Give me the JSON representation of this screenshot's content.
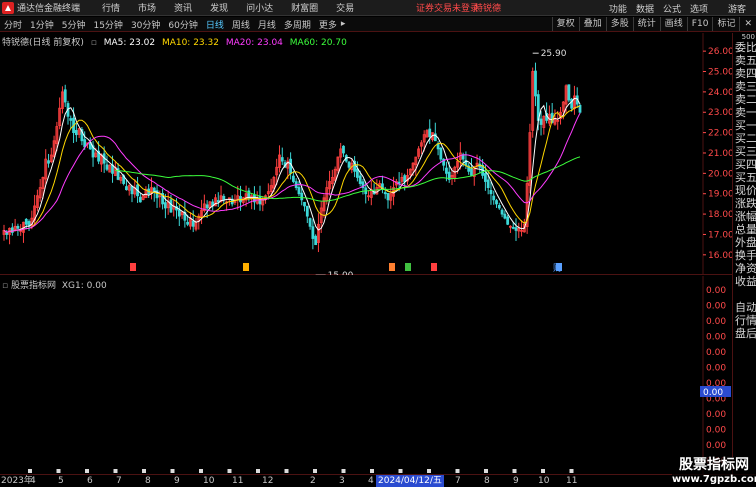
{
  "menubar": {
    "title": "通达信金融终端",
    "items": [
      "行情",
      "市场",
      "资讯",
      "发现",
      "问小达",
      "财富圈",
      "交易"
    ],
    "alert": "证券交易未登录",
    "alert_stock": "特锐德",
    "right_items": [
      "功能",
      "数据",
      "公式",
      "选项",
      "游客"
    ]
  },
  "periodbar": {
    "items": [
      "分时",
      "1分钟",
      "5分钟",
      "15分钟",
      "30分钟",
      "60分钟",
      "日线",
      "周线",
      "月线",
      "多周期",
      "更多"
    ],
    "active": "日线",
    "right_buttons": [
      "复权",
      "叠加",
      "多股",
      "统计",
      "画线",
      "F10",
      "标记",
      "✕"
    ]
  },
  "legend": {
    "title": "特锐德(日线 前复权)",
    "ma5": "MA5: 23.02",
    "ma10": "MA10: 23.32",
    "ma20": "MA20: 23.04",
    "ma60": "MA60: 20.70"
  },
  "colors": {
    "ma5": "#ffffff",
    "ma10": "#ffd700",
    "ma20": "#ff3cff",
    "ma60": "#3cff3c",
    "up": "#ff4040",
    "down": "#3cd7d7",
    "grid": "#4b1212",
    "axis_text": "#ff4a4a"
  },
  "chart_data": {
    "type": "candlestick",
    "y_ticks": [
      "26.00",
      "25.00",
      "24.00",
      "23.00",
      "22.00",
      "21.00",
      "20.00",
      "19.00",
      "18.00",
      "17.00",
      "16.00"
    ],
    "ylim": [
      15.5,
      26.4
    ],
    "high_marker": "25.90",
    "low_marker": "15.00",
    "event_markers": [
      "财"
    ],
    "closes": [
      17.2,
      17.0,
      17.3,
      17.1,
      17.4,
      17.3,
      17.2,
      17.6,
      17.5,
      17.4,
      17.8,
      18.4,
      18.9,
      19.3,
      19.8,
      20.7,
      20.5,
      20.9,
      21.6,
      22.3,
      23.2,
      24.0,
      23.5,
      22.8,
      22.6,
      22.0,
      21.9,
      22.2,
      21.6,
      21.3,
      21.5,
      21.2,
      20.8,
      21.0,
      20.6,
      20.9,
      20.5,
      20.2,
      20.4,
      20.0,
      20.3,
      19.7,
      19.8,
      19.5,
      19.2,
      19.4,
      19.0,
      19.3,
      18.9,
      18.6,
      18.9,
      19.2,
      19.0,
      19.3,
      19.1,
      18.8,
      18.9,
      18.5,
      18.3,
      18.6,
      18.1,
      18.4,
      18.2,
      17.9,
      18.1,
      17.7,
      17.5,
      17.8,
      17.4,
      17.6,
      17.9,
      18.2,
      18.5,
      18.3,
      18.6,
      18.4,
      18.8,
      18.6,
      18.9,
      18.7,
      18.6,
      18.8,
      18.5,
      18.7,
      18.9,
      18.6,
      18.8,
      19.0,
      18.8,
      18.9,
      18.6,
      18.8,
      18.5,
      18.7,
      18.9,
      19.1,
      19.4,
      19.8,
      20.3,
      20.9,
      20.6,
      20.3,
      20.6,
      20.0,
      19.6,
      19.3,
      19.0,
      18.7,
      18.4,
      17.9,
      17.4,
      16.8,
      16.5,
      17.5,
      18.3,
      18.8,
      19.3,
      19.6,
      19.8,
      20.2,
      20.8,
      21.2,
      21.0,
      20.6,
      20.3,
      20.5,
      20.1,
      19.8,
      19.5,
      19.3,
      19.0,
      18.9,
      19.2,
      19.0,
      19.3,
      19.5,
      19.2,
      19.0,
      18.7,
      19.0,
      19.3,
      19.6,
      19.5,
      19.8,
      19.6,
      19.9,
      20.2,
      20.5,
      20.8,
      21.2,
      21.5,
      21.9,
      22.1,
      21.8,
      22.0,
      21.6,
      21.2,
      20.7,
      20.4,
      20.0,
      19.7,
      19.9,
      20.3,
      20.6,
      21.0,
      20.7,
      20.4,
      20.1,
      19.9,
      20.2,
      20.5,
      20.3,
      19.9,
      19.6,
      19.3,
      19.0,
      18.7,
      18.5,
      18.3,
      18.0,
      17.8,
      17.5,
      17.4,
      17.3,
      17.2,
      17.3,
      17.2,
      17.5,
      19.5,
      22.0,
      25.0,
      23.8,
      22.6,
      22.4,
      22.8,
      22.6,
      22.9,
      22.5,
      22.7,
      22.6,
      23.0,
      23.5,
      24.3,
      23.6,
      23.2,
      23.8,
      23.4,
      23.0
    ],
    "indicator": {
      "name": "股票指标网",
      "label": "XG1: 0.00",
      "y_ticks": [
        "0.00",
        "0.00",
        "0.00",
        "0.00",
        "0.00",
        "0.00",
        "0.00",
        "0.00",
        "0.00",
        "0.00",
        "0.00",
        "0.00"
      ],
      "cursor_value": "0.00"
    }
  },
  "x_axis": {
    "labels": [
      "2023年",
      "4",
      "5",
      "6",
      "7",
      "8",
      "9",
      "10",
      "11",
      "12",
      "2",
      "3",
      "4",
      "5",
      "6",
      "7",
      "8",
      "9",
      "10",
      "11"
    ],
    "cursor_date": "2024/04/12/五"
  },
  "quote_panel": {
    "top": "500",
    "rows": [
      "委比",
      "卖五",
      "卖四",
      "卖三",
      "卖二",
      "卖一",
      "买一",
      "买二",
      "买三",
      "买四",
      "买五",
      "现价",
      "涨跌",
      "涨幅",
      "总量",
      "外盘",
      "换手",
      "净资",
      "收益",
      "",
      "自动",
      "行情",
      "盘后",
      "",
      "",
      "",
      "",
      "",
      "",
      "",
      ""
    ]
  },
  "watermark": {
    "line1": "股票指标网",
    "line2": "www.7gpzb.com"
  }
}
